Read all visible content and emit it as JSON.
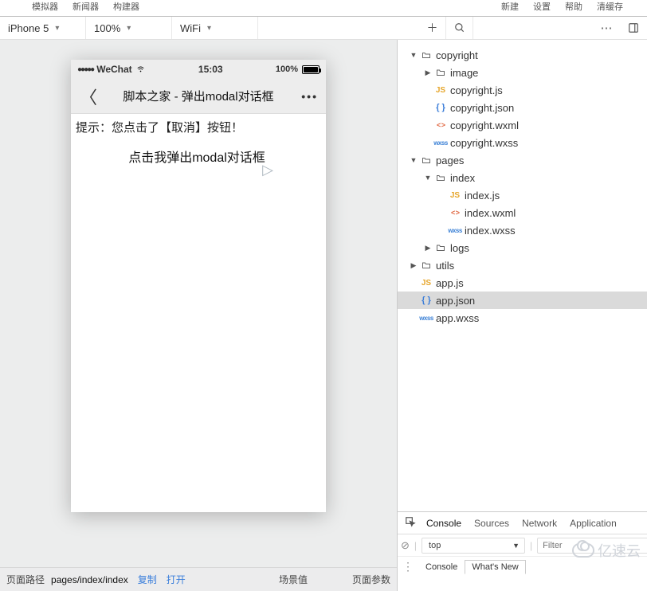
{
  "menu": {
    "left_items": [
      "模拟器",
      "新闻器",
      "构建器"
    ],
    "right_items": [
      "新建",
      "设置",
      "帮助",
      "清缓存"
    ]
  },
  "toolbar": {
    "device": "iPhone 5",
    "zoom": "100%",
    "network": "WiFi"
  },
  "phone": {
    "carrier": "WeChat",
    "time": "15:03",
    "battery": "100%",
    "nav_title": "脚本之家 - 弹出modal对话框",
    "tip_text": "提示：您点击了【取消】按钮！",
    "button_label": "点击我弹出modal对话框"
  },
  "sim_footer": {
    "page_path_label": "页面路径",
    "page_path_value": "pages/index/index",
    "copy": "复制",
    "open": "打开",
    "scene_label": "场景值",
    "params_label": "页面参数"
  },
  "tree": [
    {
      "depth": 0,
      "arrow": "▼",
      "type": "folder-open",
      "label": "copyright"
    },
    {
      "depth": 1,
      "arrow": "▶",
      "type": "folder",
      "label": "image"
    },
    {
      "depth": 1,
      "arrow": "",
      "type": "js",
      "label": "copyright.js"
    },
    {
      "depth": 1,
      "arrow": "",
      "type": "json",
      "label": "copyright.json"
    },
    {
      "depth": 1,
      "arrow": "",
      "type": "wxml",
      "label": "copyright.wxml"
    },
    {
      "depth": 1,
      "arrow": "",
      "type": "wxss",
      "label": "copyright.wxss"
    },
    {
      "depth": 0,
      "arrow": "▼",
      "type": "folder-open",
      "label": "pages"
    },
    {
      "depth": 1,
      "arrow": "▼",
      "type": "folder-open",
      "label": "index"
    },
    {
      "depth": 2,
      "arrow": "",
      "type": "js",
      "label": "index.js"
    },
    {
      "depth": 2,
      "arrow": "",
      "type": "wxml",
      "label": "index.wxml"
    },
    {
      "depth": 2,
      "arrow": "",
      "type": "wxss",
      "label": "index.wxss"
    },
    {
      "depth": 1,
      "arrow": "▶",
      "type": "folder",
      "label": "logs"
    },
    {
      "depth": 0,
      "arrow": "▶",
      "type": "folder",
      "label": "utils"
    },
    {
      "depth": 0,
      "arrow": "",
      "type": "js",
      "label": "app.js"
    },
    {
      "depth": 0,
      "arrow": "",
      "type": "json",
      "label": "app.json",
      "selected": true
    },
    {
      "depth": 0,
      "arrow": "",
      "type": "wxss",
      "label": "app.wxss"
    }
  ],
  "devtools": {
    "tabs": [
      "Console",
      "Sources",
      "Network",
      "Application"
    ],
    "active_tab": "Console",
    "context": "top",
    "filter_placeholder": "Filter",
    "sub_tabs": [
      "Console",
      "What's New"
    ],
    "active_sub_tab": "What's New"
  },
  "watermark_text": "亿速云"
}
